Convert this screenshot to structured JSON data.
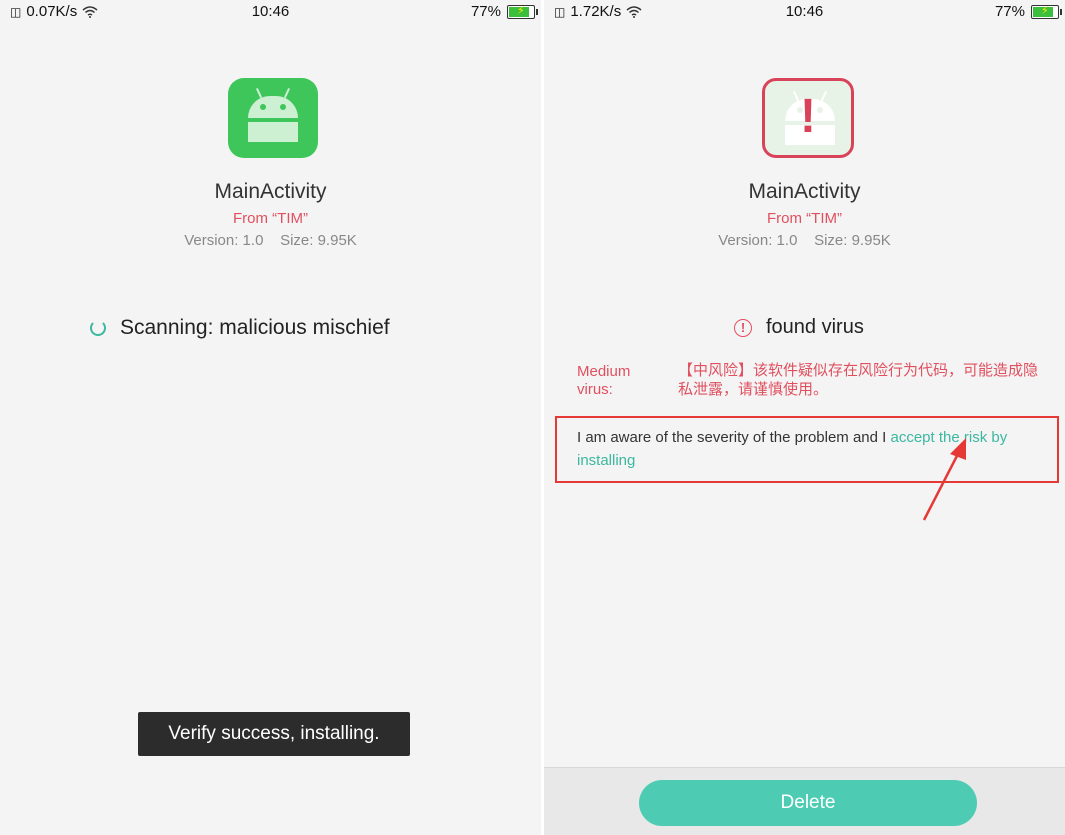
{
  "left": {
    "status": {
      "net_speed": "0.07K/s",
      "time": "10:46",
      "battery": "77%",
      "battery_level": 0.77
    },
    "app": {
      "name": "MainActivity",
      "from": "From “TIM”",
      "meta": "Version: 1.0    Size: 9.95K"
    },
    "scan_text": "Scanning: malicious mischief",
    "toast": "Verify success, installing."
  },
  "right": {
    "status": {
      "net_speed": "1.72K/s",
      "time": "10:46",
      "battery": "77%",
      "battery_level": 0.77
    },
    "app": {
      "name": "MainActivity",
      "from": "From “TIM”",
      "meta": "Version: 1.0    Size: 9.95K"
    },
    "found_text": "found virus",
    "risk_level": "Medium virus:",
    "risk_desc": "【中风险】该软件疑似存在风险行为代码，可能造成隐私泄露，请谨慎使用。",
    "accept_prefix": "I am aware of the severity of the problem and I ",
    "accept_link": "accept the risk by installing",
    "delete_label": "Delete"
  },
  "colors": {
    "accent": "#4dccb3",
    "danger": "#e0505f",
    "highlight_box": "#e53935",
    "icon_green": "#3ec65a"
  },
  "icons": [
    "sim-icon",
    "wifi-icon",
    "battery-icon",
    "android-app-icon",
    "spinner-icon",
    "warning-icon",
    "annotation-arrow-icon"
  ]
}
